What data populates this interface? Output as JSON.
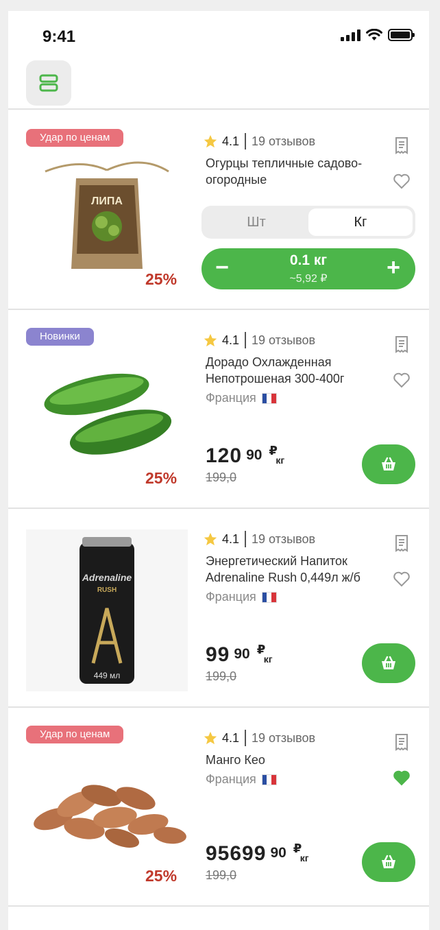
{
  "status_bar": {
    "time": "9:41"
  },
  "products": [
    {
      "badge": "Удар по ценам",
      "rating": "4.1",
      "reviews": "19 отзывов",
      "title": "Огурцы тепличные садово-огородные",
      "discount": "25%",
      "unit_toggle": {
        "options": [
          "Шт",
          "Кг"
        ],
        "selected": "Кг"
      },
      "quantity": "0.1 кг",
      "approx_price": "~5,92 ₽",
      "favorite": false
    },
    {
      "badge": "Новинки",
      "rating": "4.1",
      "reviews": "19 отзывов",
      "title": "Дорадо Охлажденная Непотрошеная 300-400г",
      "origin": "Франция",
      "price_main": "120",
      "price_cents": "90",
      "price_currency": "₽",
      "price_unit": "кг",
      "old_price": "199,0",
      "discount": "25%",
      "favorite": false
    },
    {
      "rating": "4.1",
      "reviews": "19 отзывов",
      "title": "Энергетический Напиток Adrenaline Rush 0,449л ж/б",
      "origin": "Франция",
      "price_main": "99",
      "price_cents": "90",
      "price_currency": "₽",
      "price_unit": "кг",
      "old_price": "199,0",
      "favorite": false,
      "can_brand": "Adrenaline",
      "can_sub": "RUSH",
      "can_volume": "449 мл"
    },
    {
      "badge": "Удар по ценам",
      "rating": "4.1",
      "reviews": "19 отзывов",
      "title": "Манго Кео",
      "origin": "Франция",
      "price_main": "95699",
      "price_cents": "90",
      "price_currency": "₽",
      "price_unit": "кг",
      "old_price": "199,0",
      "discount": "25%",
      "favorite": true
    }
  ],
  "package_label": "ЛИПА",
  "colors": {
    "accent": "#4cb64a",
    "badge_red": "#e8717a",
    "badge_purple": "#8b84cf",
    "discount": "#c0392b"
  }
}
